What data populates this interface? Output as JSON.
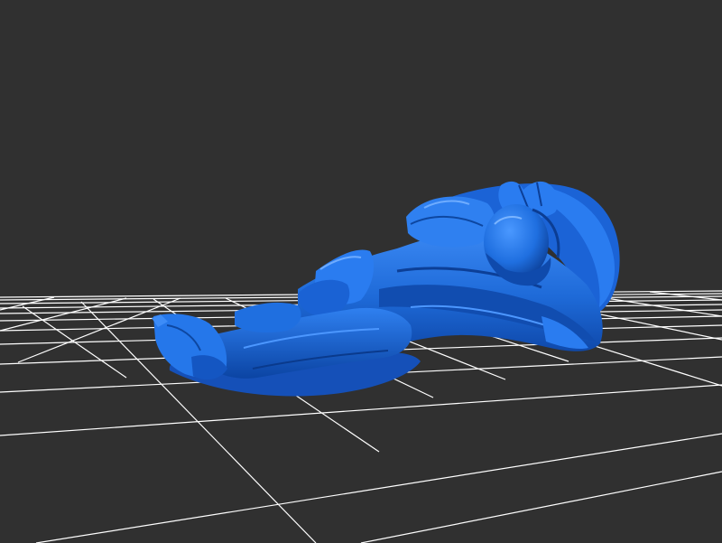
{
  "viewport": {
    "background": "#303030",
    "grid_color": "#ffffff",
    "model_color": "#1f6fe0",
    "model_shadow": "#0a3f99",
    "model_highlight": "#4c97ff",
    "model_description": "reclining-figure-statue"
  }
}
